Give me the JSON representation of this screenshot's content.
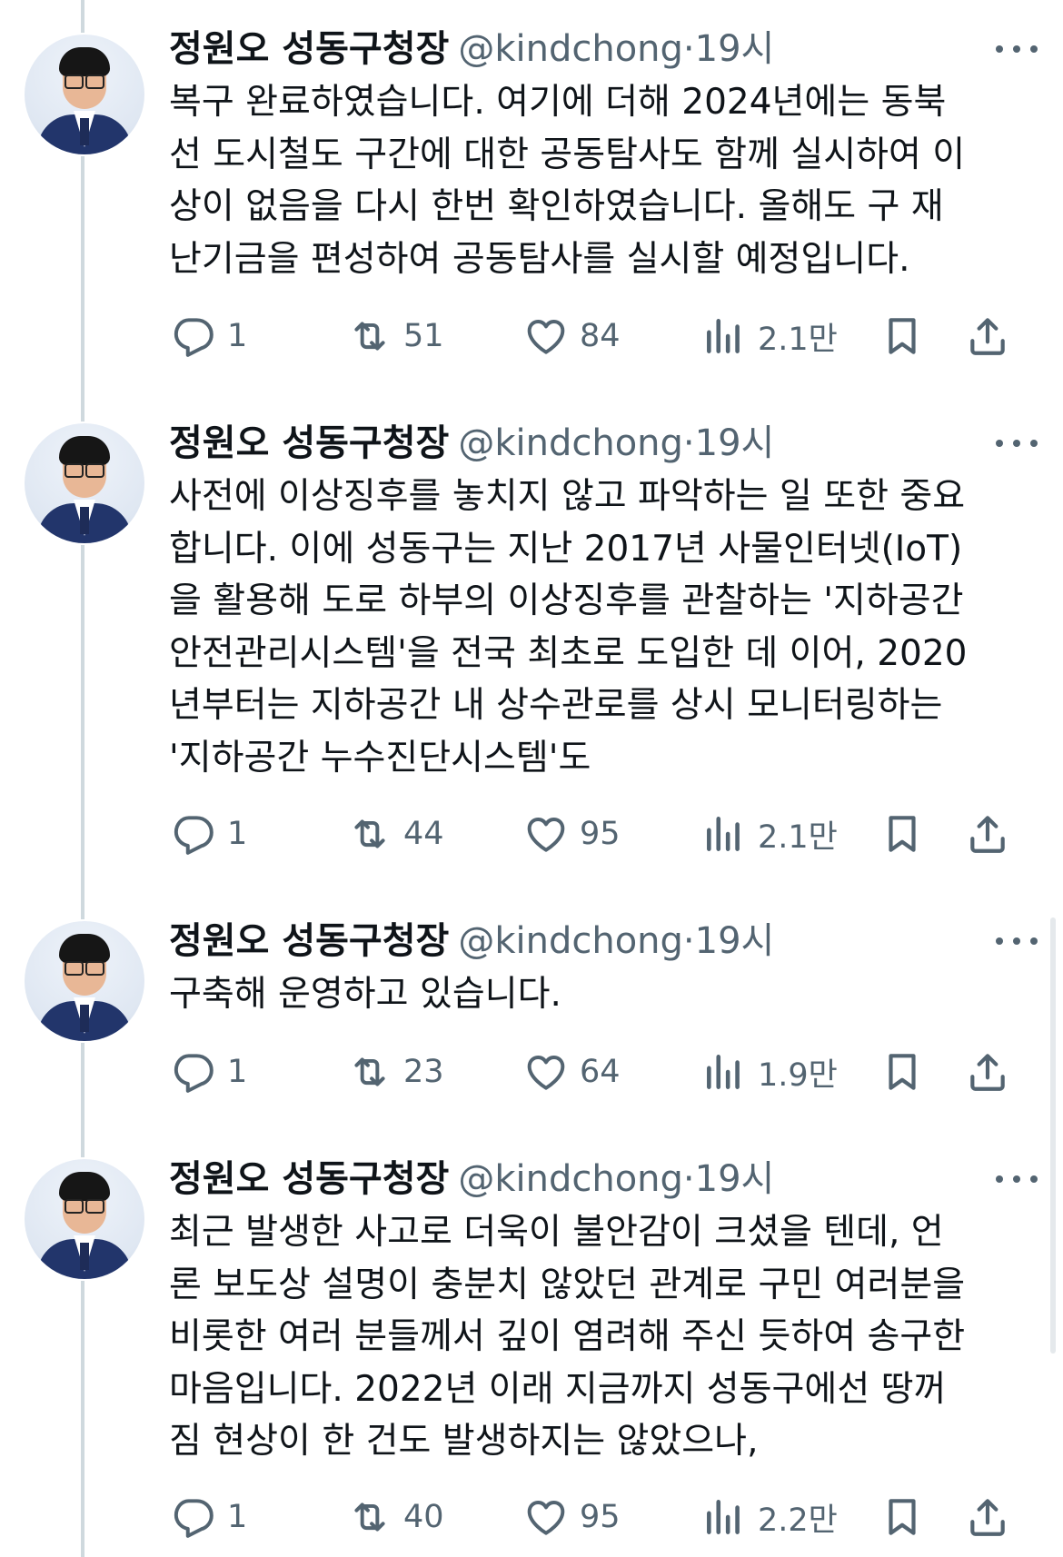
{
  "tweets": [
    {
      "name": "정원오 성동구청장",
      "handle": "@kindchong",
      "dot": "·",
      "time": "19시",
      "lines": [
        "복구 완료하였습니다. 여기에 더해 2024년에는 동북",
        "선 도시철도 구간에 대한 공동탐사도 함께 실시하여 이",
        "상이 없음을 다시 한번 확인하였습니다. 올해도 구 재",
        "난기금을 편성하여 공동탐사를 실시할 예정입니다."
      ],
      "replies": "1",
      "reposts": "51",
      "likes": "84",
      "views": "2.1만"
    },
    {
      "name": "정원오 성동구청장",
      "handle": "@kindchong",
      "dot": "·",
      "time": "19시",
      "lines": [
        "사전에 이상징후를 놓치지 않고 파악하는 일 또한 중요",
        "합니다. 이에 성동구는 지난 2017년 사물인터넷(IoT)",
        "을 활용해 도로 하부의 이상징후를 관찰하는 '지하공간",
        "안전관리시스템'을 전국 최초로 도입한 데 이어, 2020",
        "년부터는 지하공간 내 상수관로를 상시 모니터링하는",
        "'지하공간 누수진단시스템'도"
      ],
      "replies": "1",
      "reposts": "44",
      "likes": "95",
      "views": "2.1만"
    },
    {
      "name": "정원오 성동구청장",
      "handle": "@kindchong",
      "dot": "·",
      "time": "19시",
      "lines": [
        "구축해 운영하고 있습니다."
      ],
      "replies": "1",
      "reposts": "23",
      "likes": "64",
      "views": "1.9만"
    },
    {
      "name": "정원오 성동구청장",
      "handle": "@kindchong",
      "dot": "·",
      "time": "19시",
      "lines": [
        "최근 발생한 사고로 더욱이 불안감이 크셨을 텐데, 언",
        "론 보도상 설명이 충분치 않았던 관계로 구민 여러분을",
        "비롯한 여러 분들께서 깊이 염려해 주신 듯하여 송구한",
        "마음입니다. 2022년 이래 지금까지 성동구에선 땅꺼",
        "짐 현상이 한 건도 발생하지는 않았으나,"
      ],
      "replies": "1",
      "reposts": "40",
      "likes": "95",
      "views": "2.2만"
    }
  ],
  "icons": {
    "reply": "reply-icon",
    "repost": "repost-icon",
    "like": "heart-icon",
    "views": "views-icon",
    "bookmark": "bookmark-icon",
    "share": "share-icon",
    "more": "more-icon"
  },
  "colors": {
    "text": "#0f1419",
    "muted": "#536471",
    "thread_line": "#cfd9de"
  }
}
